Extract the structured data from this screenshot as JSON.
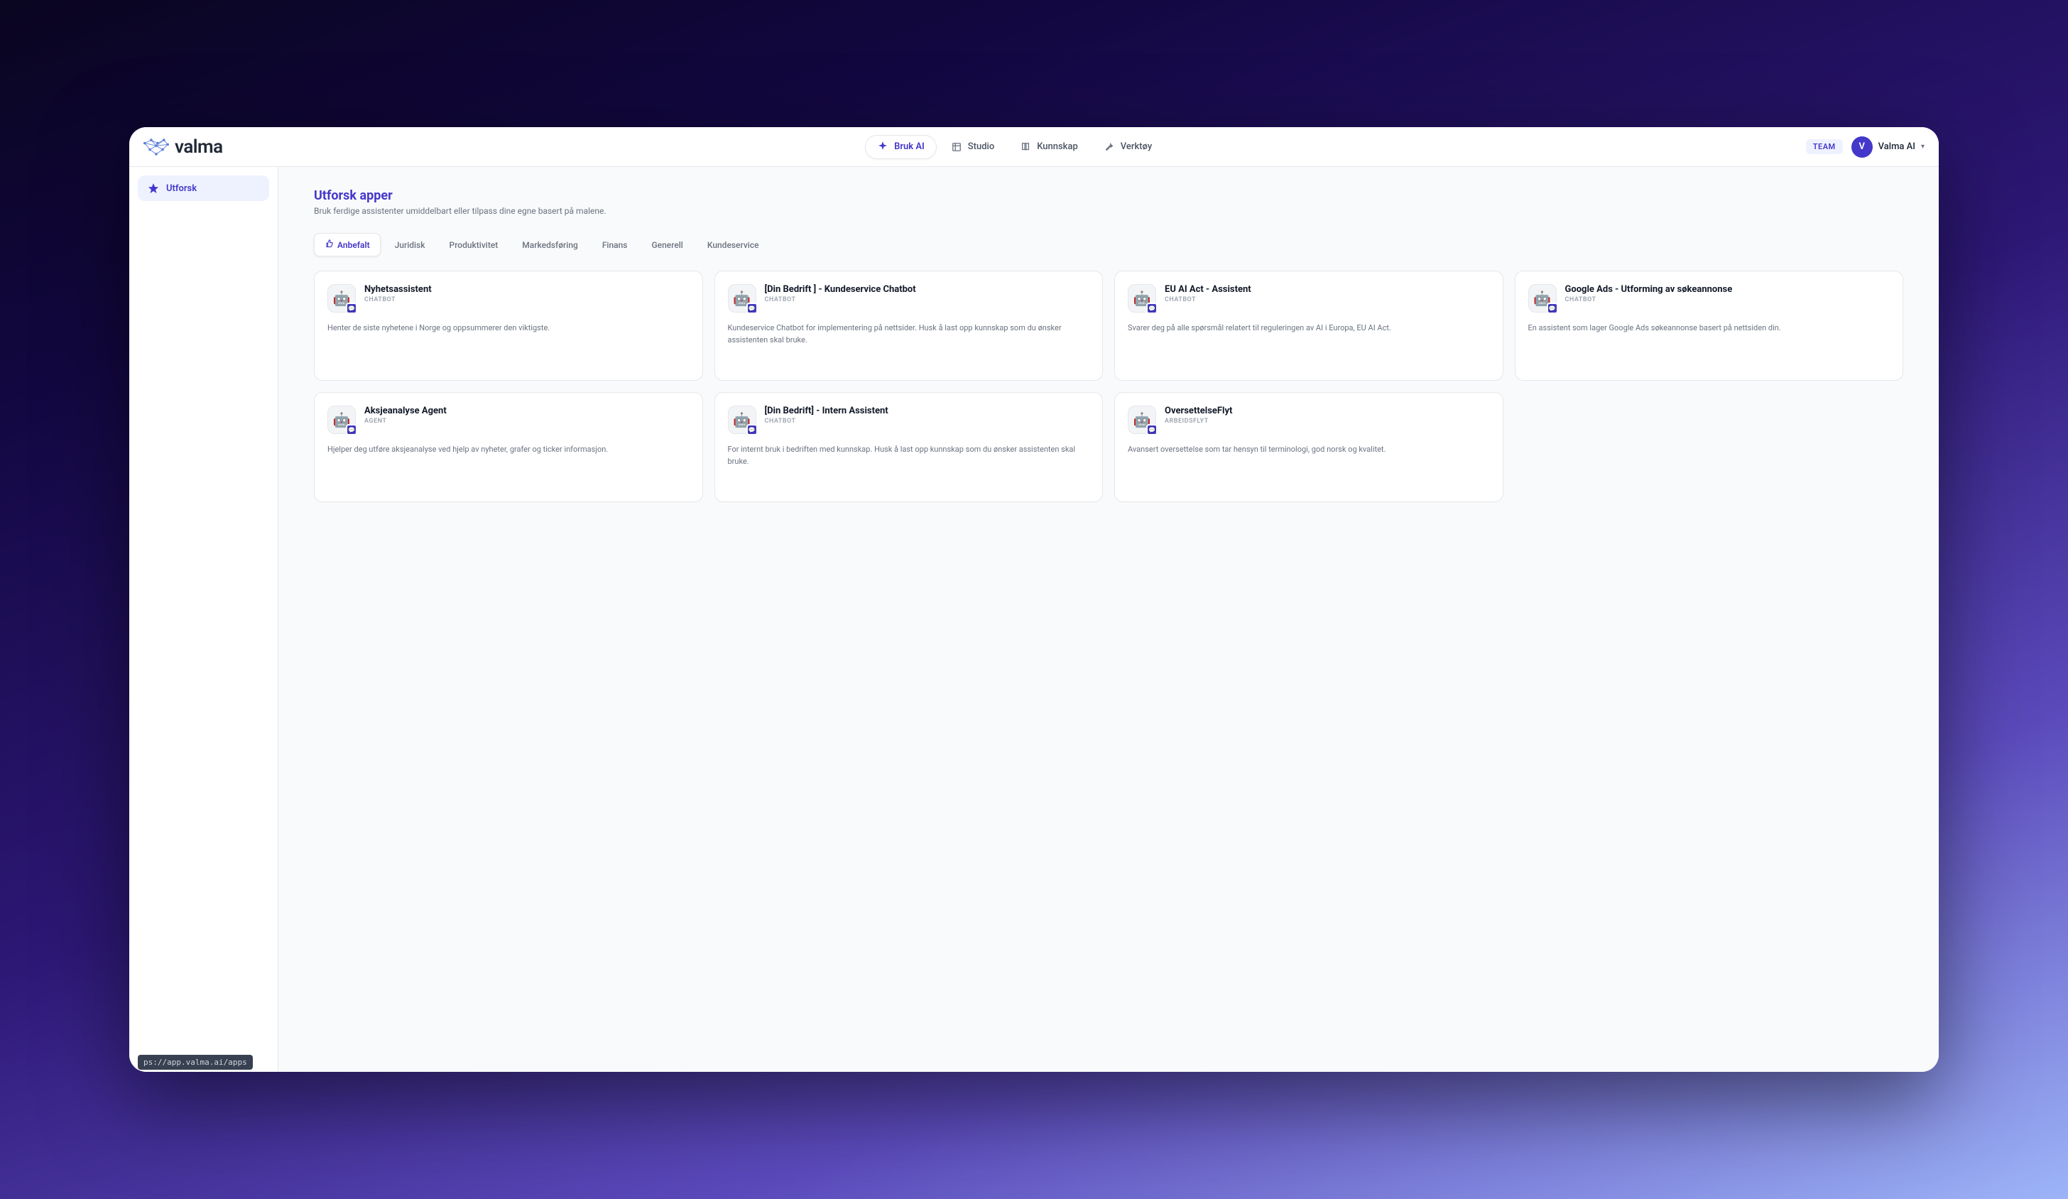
{
  "brand": {
    "name": "valma"
  },
  "nav": {
    "items": [
      {
        "label": "Bruk AI",
        "active": true
      },
      {
        "label": "Studio",
        "active": false
      },
      {
        "label": "Kunnskap",
        "active": false
      },
      {
        "label": "Verktøy",
        "active": false
      }
    ]
  },
  "topbar": {
    "team_label": "TEAM",
    "user_initial": "V",
    "user_name": "Valma AI"
  },
  "sidebar": {
    "items": [
      {
        "label": "Utforsk",
        "active": true
      }
    ]
  },
  "page": {
    "title": "Utforsk apper",
    "subtitle": "Bruk ferdige assistenter umiddelbart eller tilpass dine egne basert på malene."
  },
  "filters": [
    {
      "label": "Anbefalt",
      "active": true,
      "icon": true
    },
    {
      "label": "Juridisk",
      "active": false
    },
    {
      "label": "Produktivitet",
      "active": false
    },
    {
      "label": "Markedsføring",
      "active": false
    },
    {
      "label": "Finans",
      "active": false
    },
    {
      "label": "Generell",
      "active": false
    },
    {
      "label": "Kundeservice",
      "active": false
    }
  ],
  "cards": [
    {
      "title": "Nyhetsassistent",
      "type": "CHATBOT",
      "desc": "Henter de siste nyhetene i Norge og oppsummerer den viktigste.",
      "emoji": "🤖"
    },
    {
      "title": "[Din Bedrift ] - Kundeservice Chatbot",
      "type": "CHATBOT",
      "desc": "Kundeservice Chatbot for implementering på nettsider. Husk å last opp kunnskap som du ønsker assistenten skal bruke.",
      "emoji": "🤖"
    },
    {
      "title": "EU AI Act - Assistent",
      "type": "CHATBOT",
      "desc": "Svarer deg på alle spørsmål relatert til reguleringen av AI i Europa, EU AI Act.",
      "emoji": "🤖"
    },
    {
      "title": "Google Ads - Utforming av søkeannonse",
      "type": "CHATBOT",
      "desc": "En assistent som lager Google Ads søkeannonse basert på nettsiden din.",
      "emoji": "🤖"
    },
    {
      "title": "Aksjeanalyse Agent",
      "type": "AGENT",
      "desc": "Hjelper deg utføre aksjeanalyse ved hjelp av nyheter, grafer og ticker informasjon.",
      "emoji": "🤖"
    },
    {
      "title": "[Din Bedrift] - Intern Assistent",
      "type": "CHATBOT",
      "desc": "For internt bruk i bedriften med kunnskap. Husk å last opp kunnskap som du ønsker assistenten skal bruke.",
      "emoji": "🤖"
    },
    {
      "title": "OversettelseFlyt",
      "type": "ARBEIDSFLYT",
      "desc": "Avansert oversettelse som tar hensyn til terminologi, god norsk og kvalitet.",
      "emoji": "🤖"
    }
  ],
  "tooltip": {
    "url": "ps://app.valma.ai/apps"
  }
}
